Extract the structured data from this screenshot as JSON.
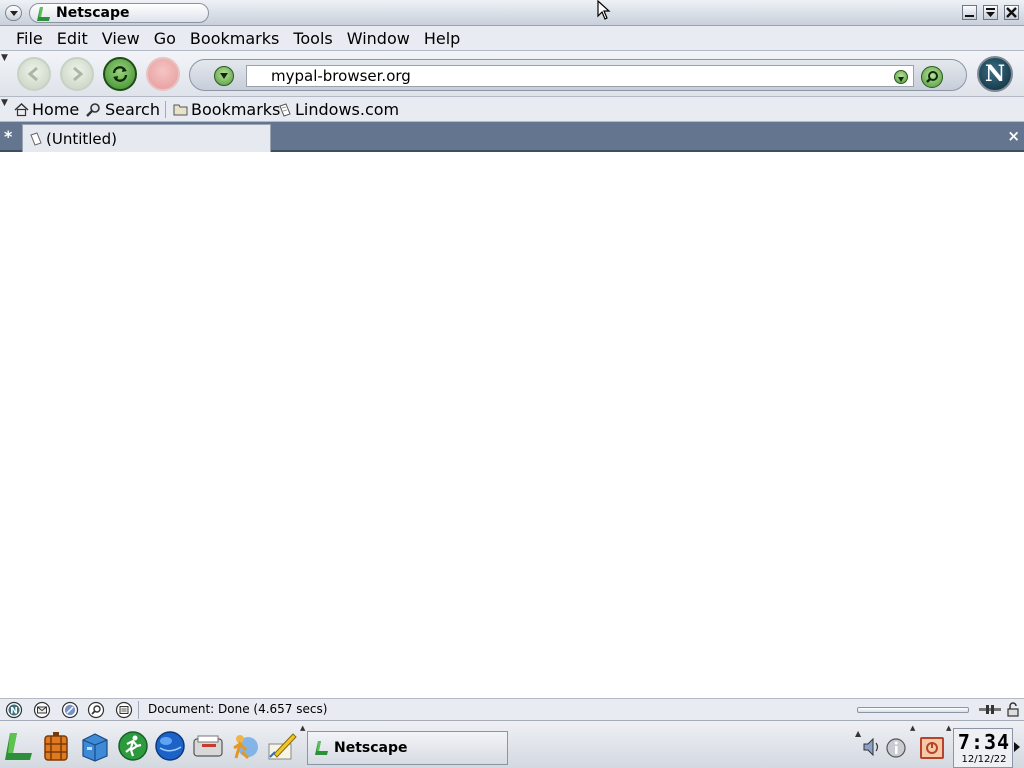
{
  "window": {
    "title": "Netscape",
    "controls": [
      "minimize",
      "maximize",
      "close"
    ]
  },
  "menubar": {
    "items": [
      {
        "label": "File"
      },
      {
        "label": "Edit"
      },
      {
        "label": "View"
      },
      {
        "label": "Go"
      },
      {
        "label": "Bookmarks"
      },
      {
        "label": "Tools"
      },
      {
        "label": "Window"
      },
      {
        "label": "Help"
      }
    ]
  },
  "navigation": {
    "url": "mypal-browser.org",
    "buttons": [
      "back",
      "forward",
      "reload",
      "stop"
    ],
    "logo_letter": "N"
  },
  "personal_toolbar": {
    "items": [
      {
        "label": "Home",
        "icon": "home-icon"
      },
      {
        "label": "Search",
        "icon": "magnifier-icon"
      },
      {
        "label": "Bookmarks",
        "icon": "folder-icon"
      },
      {
        "label": "Lindows.com",
        "icon": "bookmark-page-icon"
      }
    ]
  },
  "tabs": {
    "new_tab_glyph": "*",
    "close_glyph": "×",
    "items": [
      {
        "label": "(Untitled)",
        "active": true
      }
    ]
  },
  "statusbar": {
    "text": "Document: Done (4.657 secs)"
  },
  "taskbar": {
    "launchers": [
      "lindows-start",
      "firewall",
      "file-manager",
      "runner",
      "web-browser",
      "mail",
      "people",
      "editor"
    ],
    "task_label": "Netscape",
    "clock_time": "7:34",
    "clock_date": "12/12/22"
  },
  "colors": {
    "tabbar": "#64768f",
    "reload_green": "#3a8a2a",
    "toolbar": "#e8ebf1"
  }
}
